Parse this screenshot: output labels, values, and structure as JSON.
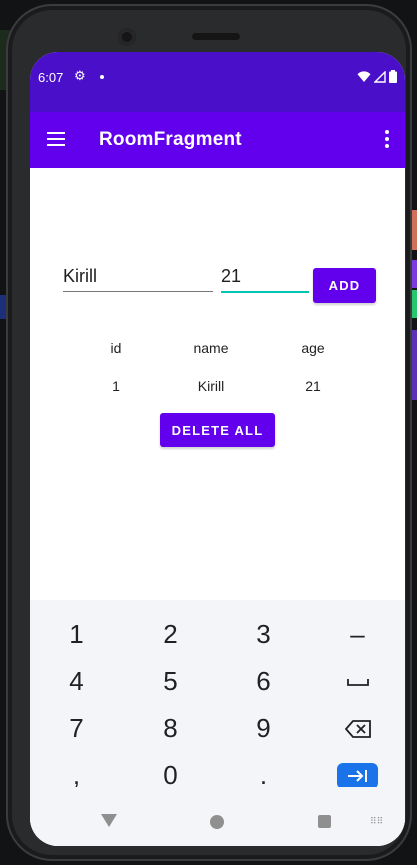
{
  "status_bar": {
    "time": "6:07"
  },
  "app_bar": {
    "title": "RoomFragment"
  },
  "form": {
    "name_value": "Kirill",
    "age_value": "21",
    "add_label": "ADD"
  },
  "table": {
    "headers": [
      "id",
      "name",
      "age"
    ],
    "rows": [
      [
        "1",
        "Kirill",
        "21"
      ]
    ]
  },
  "actions": {
    "delete_all_label": "DELETE ALL"
  },
  "keyboard": {
    "rows": [
      [
        "1",
        "2",
        "3",
        "–"
      ],
      [
        "4",
        "5",
        "6",
        "space"
      ],
      [
        "7",
        "8",
        "9",
        "backspace"
      ],
      [
        ",",
        "0",
        ".",
        "next"
      ]
    ]
  },
  "colors": {
    "status_bar": "#4a0fc9",
    "app_bar": "#6200ee",
    "button": "#6200ee",
    "accent_underline": "#03c4b1",
    "keyboard_action": "#1a73e8"
  }
}
